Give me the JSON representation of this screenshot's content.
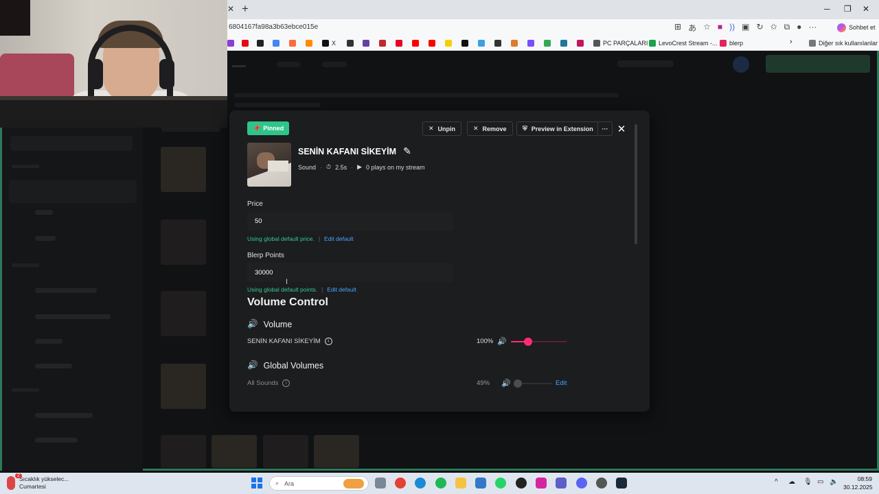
{
  "browser": {
    "url_fragment": "6804167fa98a3b63ebce015e",
    "profile_button_label": "Sohbet et",
    "bookmarks": [
      {
        "label": "X"
      },
      {
        "label": "PC PARÇALARI"
      },
      {
        "label": "LevoCrest Stream -..."
      },
      {
        "label": "blerp"
      }
    ],
    "other_bookmarks_label": "Diğer sık kullanılanlar"
  },
  "modal": {
    "pinned_label": "Pinned",
    "unpin_label": "Unpin",
    "remove_label": "Remove",
    "preview_label": "Preview in Extension",
    "more_label": "···",
    "sound": {
      "title": "SENİN KAFANI SİKEYİM",
      "type": "Sound",
      "duration": "2.5s",
      "plays": "0 plays on my stream"
    },
    "price": {
      "label": "Price",
      "value": "50",
      "hint": "Using global default price.",
      "edit_link": "Edit default"
    },
    "points": {
      "label": "Blerp Points",
      "value": "30000",
      "hint": "Using global default points.",
      "edit_link": "Edit default"
    },
    "volume_control": {
      "heading": "Volume Control",
      "volume_subheading": "Volume",
      "sound_row": {
        "label": "SENİN KAFANI SİKEYİM",
        "percent_text": "100%",
        "level": 0.3
      },
      "global_subheading": "Global Volumes",
      "all_sounds_row": {
        "label": "All Sounds",
        "percent_text": "49%",
        "level": 0.0,
        "edit_label": "Edit"
      }
    }
  },
  "taskbar": {
    "weather_title": "Sıcaklık yükselec...",
    "weather_subtitle": "Cumartesi",
    "weather_badge": "2",
    "search_placeholder": "Ara",
    "time": "08:59",
    "date": "30.12.2025"
  },
  "colors": {
    "accent_green": "#2fc48a",
    "link_blue": "#4aa3ff",
    "slider_pink": "#ff2d6f"
  }
}
